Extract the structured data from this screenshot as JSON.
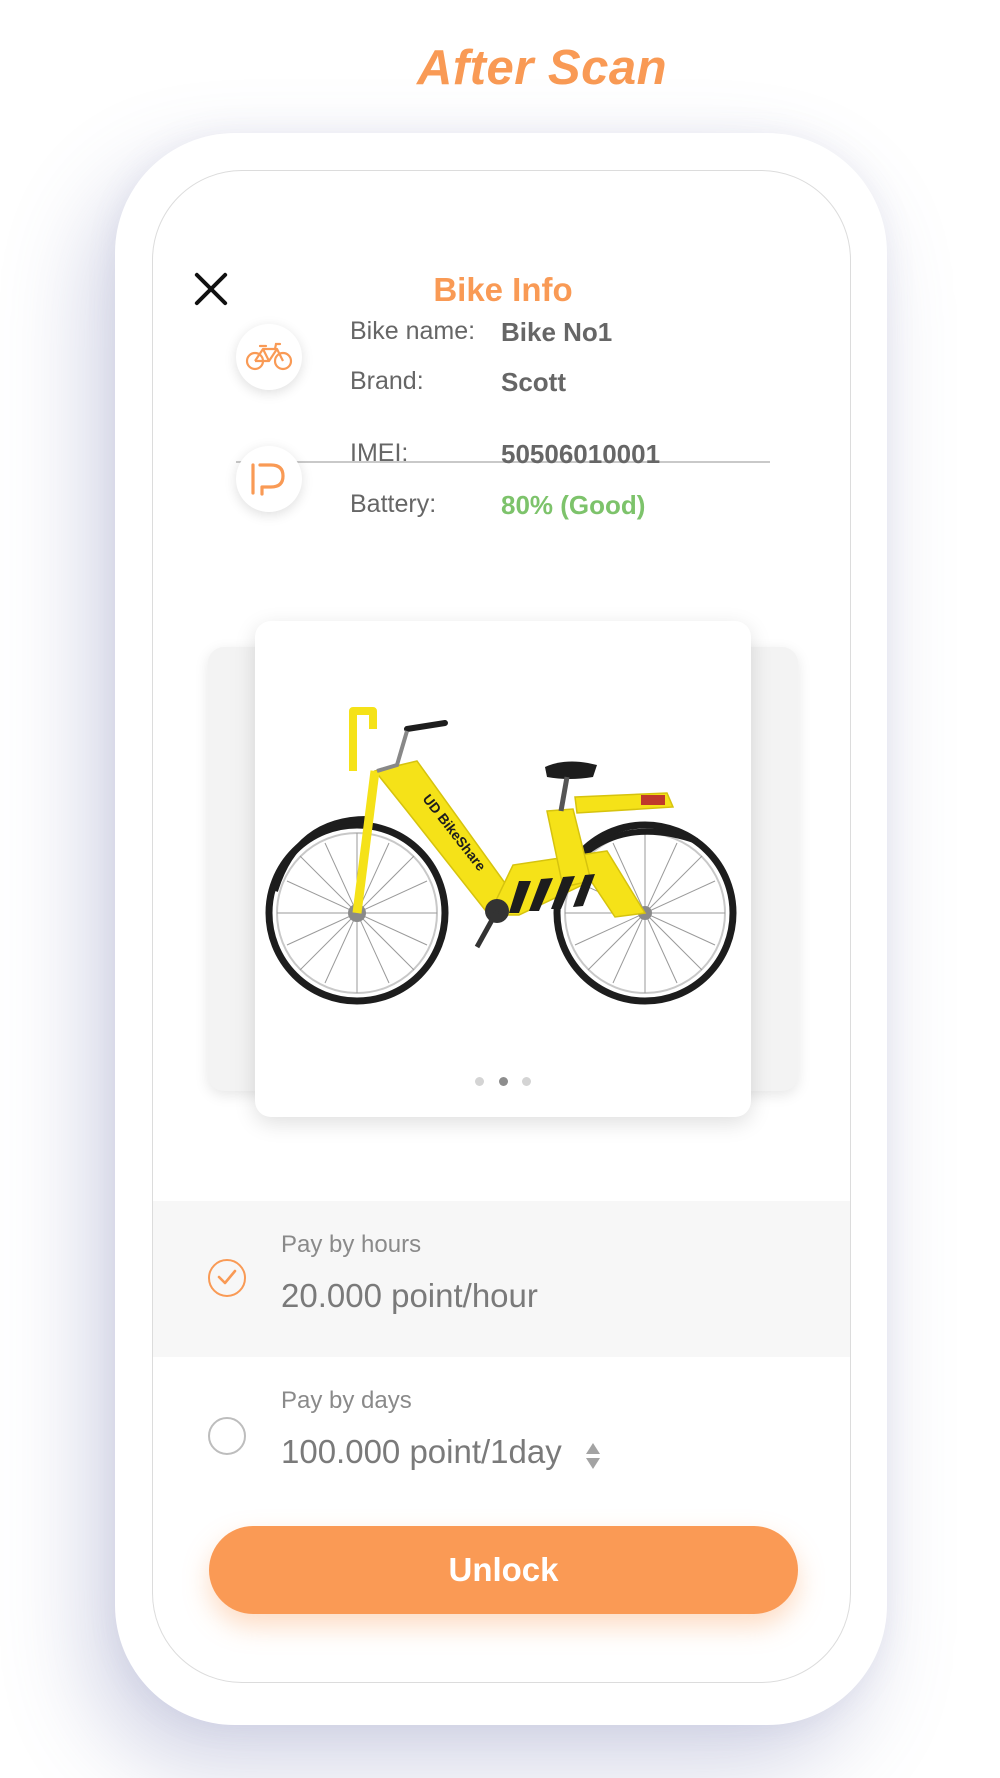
{
  "page_heading": "After Scan",
  "header": {
    "title": "Bike Info"
  },
  "bike_info": {
    "name_label": "Bike name:",
    "name_value": "Bike No1",
    "brand_label": "Brand:",
    "brand_value": "Scott",
    "imei_label": "IMEI:",
    "imei_value": "50506010001",
    "battery_label": "Battery:",
    "battery_value": "80% (Good)"
  },
  "gallery": {
    "image_text": "UD BikeShare",
    "page_count": 3,
    "active_index": 1
  },
  "payment_options": [
    {
      "label": "Pay by hours",
      "price": "20.000 point/hour",
      "selected": true
    },
    {
      "label": "Pay by days",
      "price": "100.000 point/1day",
      "selected": false
    }
  ],
  "unlock_label": "Unlock",
  "colors": {
    "accent": "#F99A55",
    "good": "#7DC36B",
    "bike_frame": "#F5E218"
  },
  "icons": [
    "close-icon",
    "bicycle-icon",
    "lock-device-icon",
    "check-icon",
    "stepper-icon"
  ]
}
